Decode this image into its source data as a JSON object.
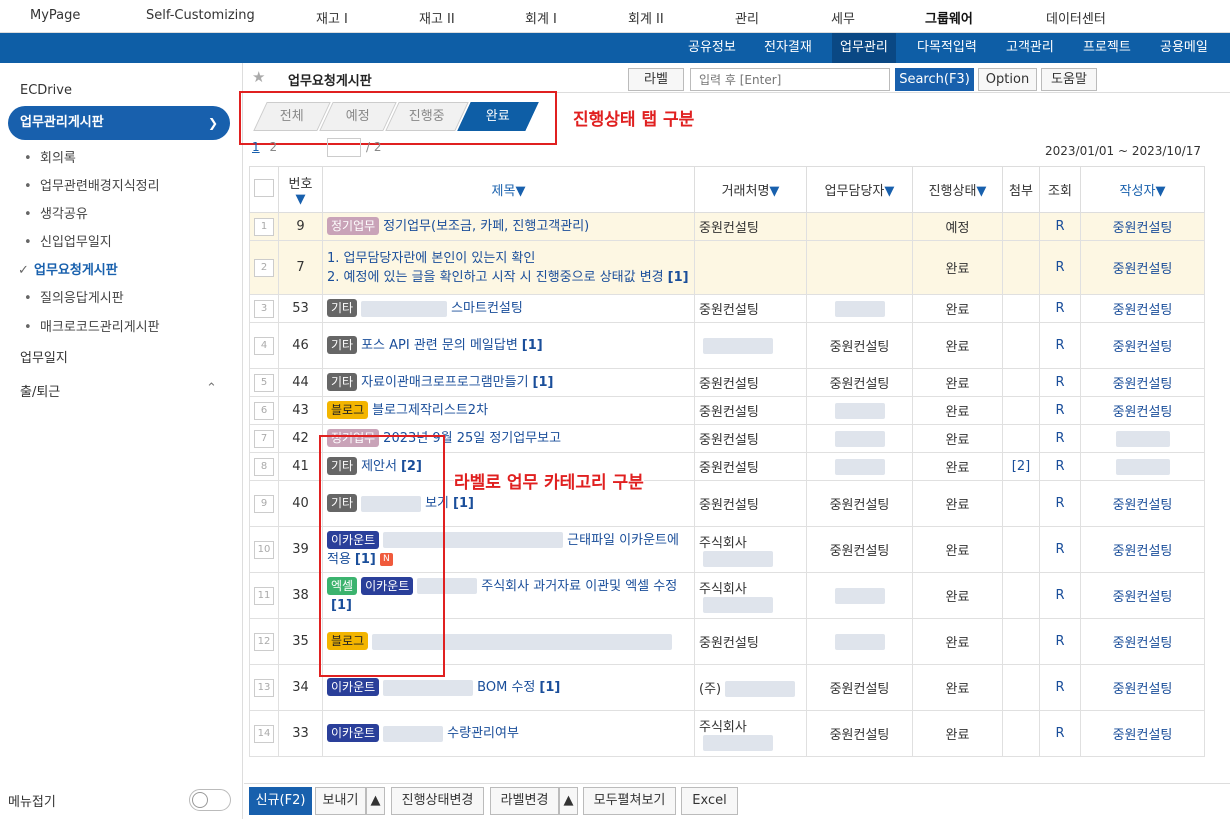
{
  "topnav": [
    "MyPage",
    "Self-Customizing",
    "재고 I",
    "재고 II",
    "회계 I",
    "회계 II",
    "관리",
    "세무",
    "그룹웨어",
    "데이터센터"
  ],
  "subnav": [
    "공유정보",
    "전자결재",
    "업무관리",
    "다목적입력",
    "고객관리",
    "프로젝트",
    "공용메일"
  ],
  "sidebar": {
    "top": "ECDrive",
    "selected": "업무관리게시판",
    "items": [
      "회의록",
      "업무관련배경지식정리",
      "생각공유",
      "신입업무일지",
      "업무요청게시판",
      "질의응답게시판",
      "매크로코드관리게시판"
    ],
    "groups": [
      "업무일지",
      "출/퇴근"
    ],
    "fold": "메뉴접기"
  },
  "toolbar": {
    "title": "업무요청게시판",
    "label_btn": "라벨",
    "search_placeholder": "입력 후 [Enter]",
    "search_btn": "Search(F3)",
    "option_btn": "Option",
    "help_btn": "도움말"
  },
  "tabs": [
    "전체",
    "예정",
    "진행중",
    "완료"
  ],
  "annotations": {
    "tabs": "진행상태 탭 구분",
    "labels": "라벨로 업무 카테고리 구분"
  },
  "pager": {
    "p1": "1",
    "p2": "2",
    "total": "/ 2"
  },
  "date_range": "2023/01/01 ~ 2023/10/17",
  "columns": {
    "num": "번호",
    "title": "제목",
    "client": "거래처명",
    "manager": "업무담당자",
    "status": "진행상태",
    "attach": "첨부",
    "view": "조회",
    "author": "작성자"
  },
  "rows": [
    {
      "idx": "1",
      "num": "9",
      "labels": [
        "정기업무"
      ],
      "title": "정기업무(보조금, 카페, 진행고객관리)",
      "client": "중원컨설팅",
      "manager": "",
      "status": "예정",
      "attach": "",
      "view": "R",
      "author": "중원컨설팅"
    },
    {
      "idx": "2",
      "num": "7",
      "labels": [],
      "title": "1. 업무담당자란에 본인이 있는지 확인\n2. 예정에 있는 글을 확인하고 시작 시 진행중으로 상태값 변경",
      "count": "[1]",
      "client": "",
      "manager": "",
      "status": "완료",
      "attach": "",
      "view": "R",
      "author": "중원컨설팅"
    },
    {
      "idx": "3",
      "num": "53",
      "labels": [
        "기타"
      ],
      "title": "스마트컨설팅",
      "client": "중원컨설팅",
      "manager": "",
      "status": "완료",
      "attach": "",
      "view": "R",
      "author": "중원컨설팅"
    },
    {
      "idx": "4",
      "num": "46",
      "labels": [
        "기타"
      ],
      "title": "포스 API 관련 문의 메일답변",
      "count": "[1]",
      "client": "",
      "manager": "중원컨설팅",
      "status": "완료",
      "attach": "",
      "view": "R",
      "author": "중원컨설팅"
    },
    {
      "idx": "5",
      "num": "44",
      "labels": [
        "기타"
      ],
      "title": "자료이관매크로프로그램만들기",
      "count": "[1]",
      "client": "중원컨설팅",
      "manager": "중원컨설팅",
      "status": "완료",
      "attach": "",
      "view": "R",
      "author": "중원컨설팅"
    },
    {
      "idx": "6",
      "num": "43",
      "labels": [
        "블로그"
      ],
      "title": "블로그제작리스트2차",
      "client": "중원컨설팅",
      "manager": "",
      "status": "완료",
      "attach": "",
      "view": "R",
      "author": "중원컨설팅"
    },
    {
      "idx": "7",
      "num": "42",
      "labels": [
        "정기업무"
      ],
      "title": "2023년 9월 25일 정기업무보고",
      "client": "중원컨설팅",
      "manager": "",
      "status": "완료",
      "attach": "",
      "view": "R",
      "author": ""
    },
    {
      "idx": "8",
      "num": "41",
      "labels": [
        "기타"
      ],
      "title": "제안서",
      "count": "[2]",
      "client": "중원컨설팅",
      "manager": "",
      "status": "완료",
      "attach": "[2]",
      "view": "R",
      "author": ""
    },
    {
      "idx": "9",
      "num": "40",
      "labels": [
        "기타"
      ],
      "title": "보기",
      "count": "[1]",
      "client": "중원컨설팅",
      "manager": "중원컨설팅",
      "status": "완료",
      "attach": "",
      "view": "R",
      "author": "중원컨설팅"
    },
    {
      "idx": "10",
      "num": "39",
      "labels": [
        "이카운트"
      ],
      "title": "근태파일 이카운트에 적용",
      "count": "[1]",
      "client": "주식회사",
      "manager": "중원컨설팅",
      "status": "완료",
      "attach": "",
      "view": "R",
      "author": "중원컨설팅"
    },
    {
      "idx": "11",
      "num": "38",
      "labels": [
        "엑셀",
        "이카운트"
      ],
      "title": "주식회사 과거자료 이관및 엑셀 수정",
      "count": "[1]",
      "client": "주식회사",
      "manager": "",
      "status": "완료",
      "attach": "",
      "view": "R",
      "author": "중원컨설팅"
    },
    {
      "idx": "12",
      "num": "35",
      "labels": [
        "블로그"
      ],
      "title": "",
      "client": "중원컨설팅",
      "manager": "",
      "status": "완료",
      "attach": "",
      "view": "R",
      "author": "중원컨설팅"
    },
    {
      "idx": "13",
      "num": "34",
      "labels": [
        "이카운트"
      ],
      "title": "BOM 수정",
      "count": "[1]",
      "client": "(주)",
      "manager": "중원컨설팅",
      "status": "완료",
      "attach": "",
      "view": "R",
      "author": "중원컨설팅"
    },
    {
      "idx": "14",
      "num": "33",
      "labels": [
        "이카운트"
      ],
      "title": "수량관리여부",
      "client": "주식회사",
      "manager": "중원컨설팅",
      "status": "완료",
      "attach": "",
      "view": "R",
      "author": "중원컨설팅"
    }
  ],
  "bottom": {
    "new": "신규(F2)",
    "send": "보내기",
    "status_change": "진행상태변경",
    "label_change": "라벨변경",
    "expand": "모두펼쳐보기",
    "excel": "Excel"
  },
  "colors": {
    "primary": "#0e5ea6",
    "annotation": "#e02020"
  }
}
